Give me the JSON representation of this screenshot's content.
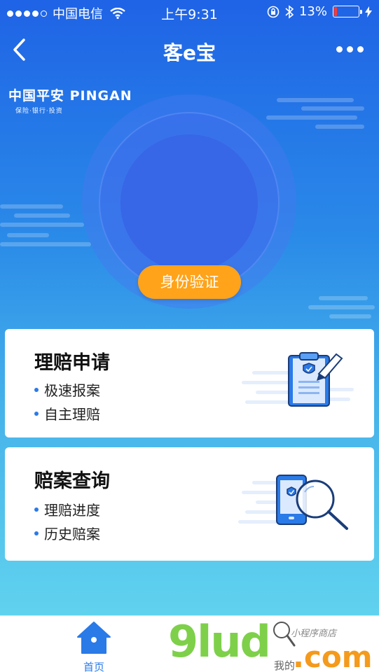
{
  "status_bar": {
    "carrier": "中国电信",
    "time": "上午9:31",
    "battery": "13%"
  },
  "nav": {
    "title": "客e宝"
  },
  "logo": {
    "main": "中国平安 PINGAN",
    "sub": "保险·银行·投资"
  },
  "verify_button": "身份验证",
  "cards": [
    {
      "title": "理赔申请",
      "items": [
        "极速报案",
        "自主理赔"
      ]
    },
    {
      "title": "赔案查询",
      "items": [
        "理赔进度",
        "历史赔案"
      ]
    }
  ],
  "tabs": [
    {
      "label": "首页",
      "active": true
    },
    {
      "label": "我的",
      "active": false
    }
  ],
  "watermark": {
    "main": "9lud",
    "com": ".com",
    "small": "小程序商店"
  },
  "colors": {
    "accent": "#2a7ae8",
    "button": "#ffa31a",
    "battery_low": "#ff3b30"
  }
}
